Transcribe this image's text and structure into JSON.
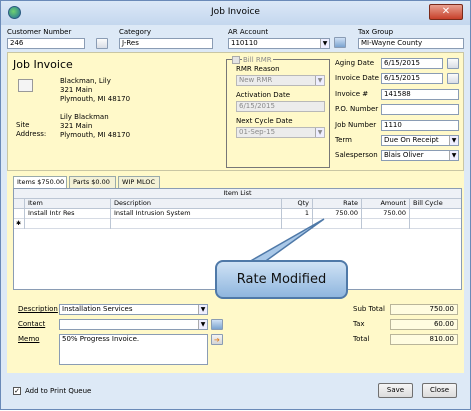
{
  "window": {
    "title": "Job Invoice"
  },
  "header": {
    "customer_number_label": "Customer Number",
    "customer_number_value": "246",
    "category_label": "Category",
    "category_value": "J-Res",
    "ar_account_label": "AR Account",
    "ar_account_value": "110110",
    "tax_group_label": "Tax Group",
    "tax_group_value": "MI-Wayne County"
  },
  "invoice": {
    "heading": "Job Invoice",
    "bill_to": {
      "name": "Blackman, Lily",
      "street": "321 Main",
      "city": "Plymouth, MI  48170"
    },
    "site_label_1": "Site",
    "site_label_2": "Address:",
    "site": {
      "name": "Lily Blackman",
      "street": "321 Main",
      "city": "Plymouth, MI  48170"
    }
  },
  "rmr": {
    "bill_rmr_label": "Bill RMR",
    "reason_label": "RMR Reason",
    "reason_value": "New RMR",
    "activation_label": "Activation Date",
    "activation_value": "6/15/2015",
    "next_cycle_label": "Next Cycle Date",
    "next_cycle_value": "01-Sep-15"
  },
  "details": {
    "aging_date_label": "Aging Date",
    "aging_date_value": "6/15/2015",
    "invoice_date_label": "Invoice Date",
    "invoice_date_value": "6/15/2015",
    "invoice_num_label": "Invoice #",
    "invoice_num_value": "141588",
    "po_number_label": "P.O. Number",
    "po_number_value": "",
    "job_number_label": "Job Number",
    "job_number_value": "1110",
    "term_label": "Term",
    "term_value": "Due On Receipt",
    "salesperson_label": "Salesperson",
    "salesperson_value": "Blais Oliver"
  },
  "tabs": [
    {
      "label": "Items  $750.00"
    },
    {
      "label": "Parts  $0.00"
    },
    {
      "label": "WIP MLOC"
    }
  ],
  "item_list": {
    "title": "Item List",
    "columns": [
      "Item",
      "Description",
      "Qty",
      "Rate",
      "Amount",
      "Bill Cycle"
    ],
    "rows": [
      {
        "item": "Install Intr Res",
        "description": "Install Intrusion System",
        "qty": "1",
        "rate": "750.00",
        "amount": "750.00",
        "bill_cycle": ""
      }
    ],
    "new_row_marker": "✱"
  },
  "callout": {
    "text": "Rate Modified"
  },
  "footer_fields": {
    "description_label": "Description",
    "description_value": "Installation Services",
    "contact_label": "Contact",
    "contact_value": "",
    "memo_label": "Memo",
    "memo_value": "50% Progress Invoice."
  },
  "totals": {
    "subtotal_label": "Sub Total",
    "subtotal_value": "750.00",
    "tax_label": "Tax",
    "tax_value": "60.00",
    "total_label": "Total",
    "total_value": "810.00"
  },
  "bottom": {
    "print_queue_label": "Add to Print Queue",
    "print_queue_checked": true,
    "save_label": "Save",
    "close_label": "Close"
  }
}
